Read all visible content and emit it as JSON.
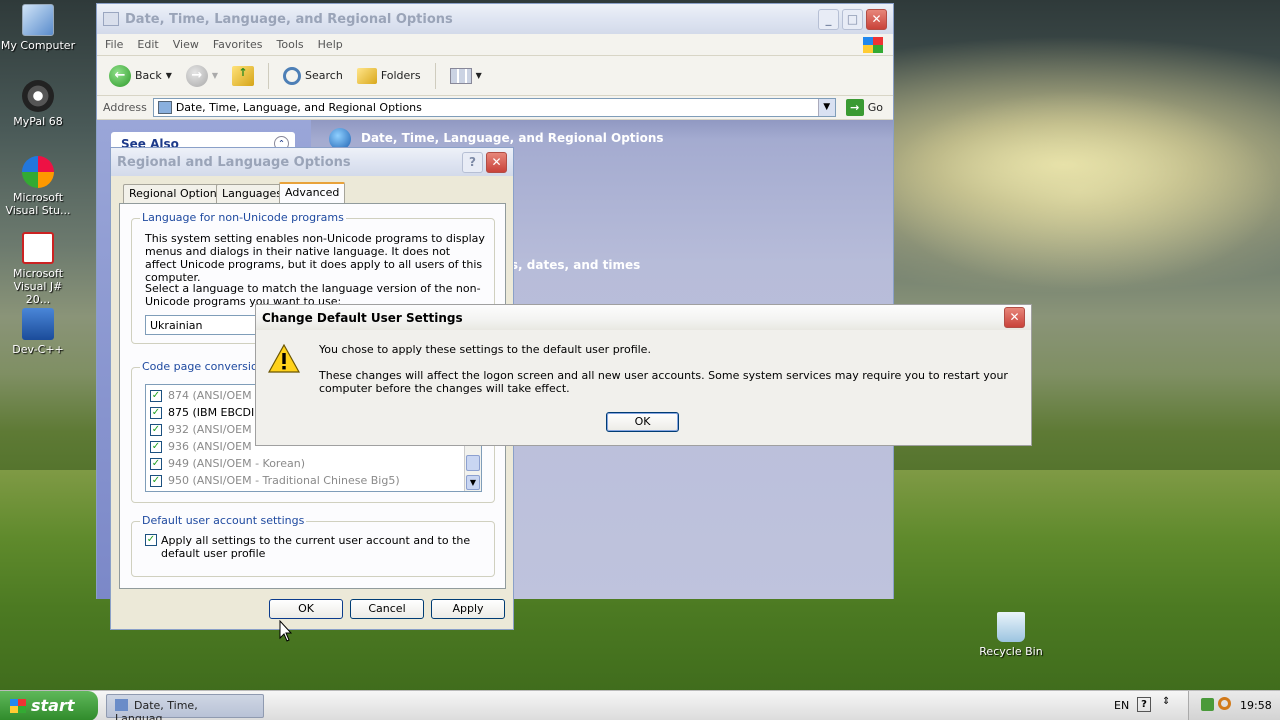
{
  "desktop": {
    "icons": [
      {
        "label": "My Computer"
      },
      {
        "label": "MyPal 68"
      },
      {
        "label": "Microsoft Visual Stu..."
      },
      {
        "label": "Microsoft Visual J# 20..."
      },
      {
        "label": "Dev-C++"
      },
      {
        "label": "Recycle Bin"
      }
    ]
  },
  "explorer": {
    "title": "Date, Time, Language, and Regional Options",
    "menu": [
      "File",
      "Edit",
      "View",
      "Favorites",
      "Tools",
      "Help"
    ],
    "toolbar": {
      "back": "Back",
      "search": "Search",
      "folders": "Folders"
    },
    "address_label": "Address",
    "address_value": "Date, Time, Language, and Regional Options",
    "go_label": "Go",
    "see_also": "See Also",
    "header_title": "Date, Time, Language, and Regional Options",
    "partial_text": "rs, dates, and times"
  },
  "regional": {
    "title": "Regional and Language Options",
    "tabs": [
      "Regional Options",
      "Languages",
      "Advanced"
    ],
    "group1_legend": "Language for non-Unicode programs",
    "group1_desc": "This system setting enables non-Unicode programs to display menus and dialogs in their native language. It does not affect Unicode programs, but it does apply to all users of this computer.",
    "group1_select_prompt": "Select a language to match the language version of the non-Unicode programs you want to use:",
    "language_value": "Ukrainian",
    "group2_legend": "Code page conversion t",
    "code_pages": [
      {
        "text": "874   (ANSI/OEM",
        "active": false
      },
      {
        "text": "875   (IBM EBCDI",
        "active": true
      },
      {
        "text": "932   (ANSI/OEM",
        "active": false
      },
      {
        "text": "936   (ANSI/OEM",
        "active": false
      },
      {
        "text": "949   (ANSI/OEM - Korean)",
        "active": false
      },
      {
        "text": "950   (ANSI/OEM - Traditional Chinese Big5)",
        "active": false
      }
    ],
    "group3_legend": "Default user account settings",
    "apply_all_label": "Apply all settings to the current user account and to the default user profile",
    "buttons": {
      "ok": "OK",
      "cancel": "Cancel",
      "apply": "Apply"
    }
  },
  "dialog": {
    "title": "Change Default User Settings",
    "line1": "You chose to apply these settings to the default user profile.",
    "line2": "These changes will affect the logon screen and all new user accounts. Some system services may require you to restart your computer before the changes will take effect.",
    "ok": "OK"
  },
  "taskbar": {
    "start": "start",
    "task": "Date, Time, Languag...",
    "lang": "EN",
    "clock": "19:58"
  }
}
